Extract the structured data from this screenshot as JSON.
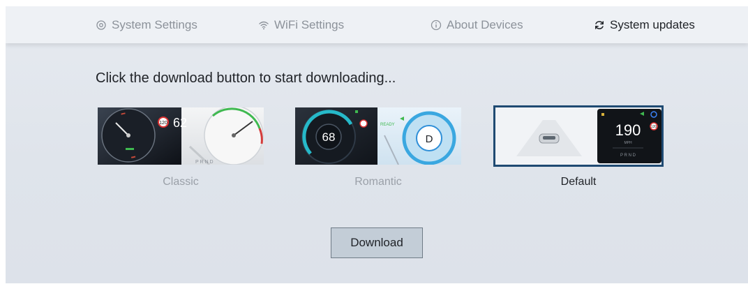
{
  "tabs": [
    {
      "label": "System Settings",
      "icon": "gear-icon"
    },
    {
      "label": "WiFi Settings",
      "icon": "wifi-icon"
    },
    {
      "label": "About Devices",
      "icon": "info-icon"
    },
    {
      "label": "System updates",
      "icon": "refresh-icon",
      "active": true
    }
  ],
  "main": {
    "instruction": "Click the download button to start downloading...",
    "themes": [
      {
        "label": "Classic",
        "selected": false,
        "preview": {
          "speed_limit": "120",
          "speed": "62",
          "gears": "P R N D"
        }
      },
      {
        "label": "Romantic",
        "selected": false,
        "preview": {
          "speed": "68",
          "gear": "D",
          "status": "READY"
        }
      },
      {
        "label": "Default",
        "selected": true,
        "preview": {
          "speed": "190",
          "unit": "MPH",
          "speed_limit": "120",
          "gears": "P R N D"
        }
      }
    ],
    "download_label": "Download"
  },
  "colors": {
    "selected_outline": "#1f4a72",
    "active_tab_text": "#1f2227",
    "inactive_tab_text": "#8c929a",
    "button_bg": "#c3cdd7"
  }
}
